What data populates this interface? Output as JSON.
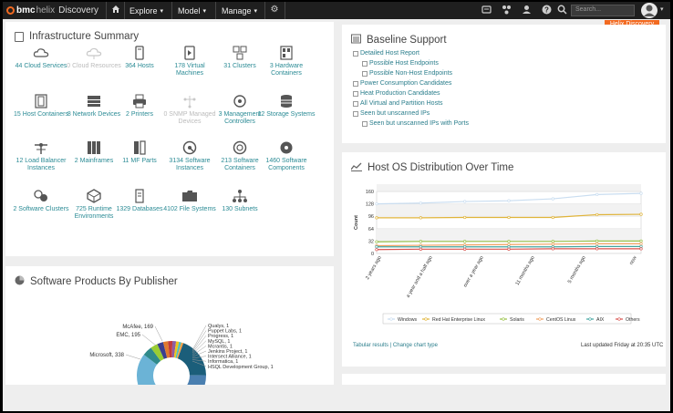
{
  "topbar": {
    "brand_bmc": "bmc",
    "brand_helix": "helix",
    "brand_app": "Discovery",
    "nav": [
      {
        "label": "Explore",
        "icon": "chevron-down-icon"
      },
      {
        "label": "Model",
        "icon": "chevron-down-icon"
      },
      {
        "label": "Manage",
        "icon": "chevron-down-icon"
      }
    ],
    "search_placeholder": "Search...",
    "badge": "Helix Discovery"
  },
  "infra": {
    "title": "Infrastructure Summary",
    "tiles": [
      {
        "label": "44 Cloud Services",
        "icon": "cloud-icon",
        "dim": false
      },
      {
        "label": "0 Cloud Resources",
        "icon": "cloud-resource-icon",
        "dim": true
      },
      {
        "label": "364 Hosts",
        "icon": "host-icon",
        "dim": false
      },
      {
        "label": "178 Virtual Machines",
        "icon": "vm-icon",
        "dim": false
      },
      {
        "label": "31 Clusters",
        "icon": "cluster-icon",
        "dim": false
      },
      {
        "label": "3 Hardware Containers",
        "icon": "hardware-container-icon",
        "dim": false
      },
      {
        "label": "15 Host Containers",
        "icon": "host-container-icon",
        "dim": false
      },
      {
        "label": "8 Network Devices",
        "icon": "network-device-icon",
        "dim": false
      },
      {
        "label": "2 Printers",
        "icon": "printer-icon",
        "dim": false
      },
      {
        "label": "0 SNMP Managed Devices",
        "icon": "snmp-icon",
        "dim": true
      },
      {
        "label": "3 Management Controllers",
        "icon": "management-controller-icon",
        "dim": false
      },
      {
        "label": "12 Storage Systems",
        "icon": "storage-icon",
        "dim": false
      },
      {
        "label": "12 Load Balancer Instances",
        "icon": "load-balancer-icon",
        "dim": false
      },
      {
        "label": "2 Mainframes",
        "icon": "mainframe-icon",
        "dim": false
      },
      {
        "label": "11 MF Parts",
        "icon": "mf-part-icon",
        "dim": false
      },
      {
        "label": "3134 Software Instances",
        "icon": "software-instance-icon",
        "dim": false
      },
      {
        "label": "213 Software Containers",
        "icon": "software-container-icon",
        "dim": false
      },
      {
        "label": "1460 Software Components",
        "icon": "software-component-icon",
        "dim": false
      },
      {
        "label": "2 Software Clusters",
        "icon": "software-cluster-icon",
        "dim": false
      },
      {
        "label": "725 Runtime Environments",
        "icon": "runtime-icon",
        "dim": false
      },
      {
        "label": "1329 Databases",
        "icon": "database-icon",
        "dim": false
      },
      {
        "label": "4102 File Systems",
        "icon": "filesystem-icon",
        "dim": false
      },
      {
        "label": "130 Subnets",
        "icon": "subnet-icon",
        "dim": false
      }
    ]
  },
  "baseline": {
    "title": "Baseline Support",
    "items": [
      {
        "label": "Detailed Host Report",
        "indent": 0
      },
      {
        "label": "Possible Host Endpoints",
        "indent": 1
      },
      {
        "label": "Possible Non-Host Endpoints",
        "indent": 1
      },
      {
        "label": "Power Consumption Candidates",
        "indent": 0
      },
      {
        "label": "Heat Production Candidates",
        "indent": 0
      },
      {
        "label": "All Virtual and Partition Hosts",
        "indent": 0
      },
      {
        "label": "Seen but unscanned IPs",
        "indent": 0
      },
      {
        "label": "Seen but unscanned IPs with Ports",
        "indent": 1
      }
    ]
  },
  "software_products": {
    "title": "Software Products By Publisher",
    "left_labels": [
      "McAfee, 169",
      "EMC, 195",
      "Microsoft, 338"
    ],
    "right_labels": [
      "Qualys, 1",
      "Puppet Labs, 1",
      "Progress, 1",
      "MySQL, 1",
      "Mcrantis, 1",
      "Jenkins Project, 1",
      "Intersect Alliance, 1",
      "Informatica, 1",
      "HSQL Development Group, 1"
    ],
    "colors": [
      "#1b5e7a",
      "#4a7fb0",
      "#6bb3d6",
      "#2f8a8a",
      "#9acd32",
      "#3b3f8f",
      "#e07a2e",
      "#c23b3b",
      "#8e5ea2",
      "#f0c419",
      "#4bc0c0",
      "#ff9f40"
    ]
  },
  "chart": {
    "title": "Host OS Distribution Over Time",
    "footer_links": "Tabular results | Change chart type",
    "footer_note": "Last updated Friday at 20:35 UTC"
  },
  "chart_data": {
    "type": "line",
    "title": "Host OS Distribution Over Time",
    "ylabel": "Count",
    "ylim": [
      0,
      160
    ],
    "yticks": [
      0,
      32,
      64,
      96,
      128,
      160
    ],
    "x": [
      "2 years ago",
      "a year and a half ago",
      "over a year ago",
      "11 months ago",
      "5 months ago",
      "now"
    ],
    "series": [
      {
        "name": "Windows",
        "color": "#c9ddf0",
        "values": [
          128,
          130,
          134,
          136,
          141,
          152,
          155
        ]
      },
      {
        "name": "Red Hat Enterprise Linux",
        "color": "#e0b43a",
        "values": [
          92,
          92,
          93,
          93,
          93,
          100,
          101
        ]
      },
      {
        "name": "Solaris",
        "color": "#9ac24a",
        "values": [
          30,
          31,
          31,
          31,
          31,
          32,
          32
        ]
      },
      {
        "name": "CentOS Linux",
        "color": "#f0a060",
        "values": [
          20,
          21,
          22,
          23,
          24,
          25,
          25
        ]
      },
      {
        "name": "AIX",
        "color": "#44a5a0",
        "values": [
          17,
          17,
          17,
          17,
          17,
          18,
          18
        ]
      },
      {
        "name": "Others",
        "color": "#d9534f",
        "values": [
          10,
          11,
          11,
          11,
          12,
          12,
          12
        ]
      }
    ]
  }
}
